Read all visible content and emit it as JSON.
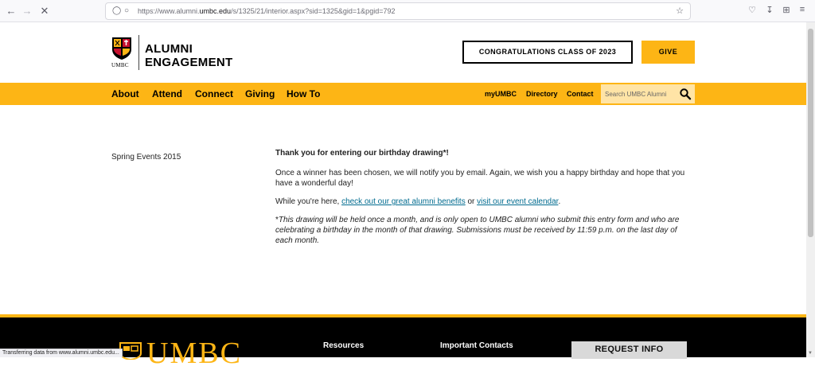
{
  "browser": {
    "url_prefix": "https://www.alumni.",
    "url_domain": "umbc.edu",
    "url_suffix": "/s/1325/21/interior.aspx?sid=1325&gid=1&pgid=792",
    "icons": [
      "back-icon",
      "forward-icon",
      "stop-icon",
      "shield-icon",
      "lock-icon",
      "bookmark-star-icon",
      "pocket-icon",
      "download-icon",
      "extensions-icon",
      "menu-icon"
    ],
    "status_text": "Transferring data from www.alumni.umbc.edu..."
  },
  "header": {
    "logo_small": "UMBC",
    "logo_line1": "ALUMNI",
    "logo_line2": "ENGAGEMENT",
    "congrats_button": "CONGRATULATIONS CLASS OF 2023",
    "give_button": "GIVE"
  },
  "nav": {
    "main": [
      "About",
      "Attend",
      "Connect",
      "Giving",
      "How To"
    ],
    "utility": [
      "myUMBC",
      "Directory",
      "Contact"
    ],
    "search_placeholder": "Search UMBC Alumni"
  },
  "sidebar": {
    "label": "Spring Events 2015"
  },
  "content": {
    "lead": "Thank  you for entering our birthday drawing*!",
    "para1": "Once a winner has been chosen, we will notify you by email. Again, we wish you a happy birthday and hope that you have a wonderful day!",
    "para2_prefix": "While you're here, ",
    "link1": "check out our great alumni benefits",
    "para2_mid": " or ",
    "link2": "visit our event calendar",
    "para2_suffix": ".",
    "note_star": "*",
    "note": "This drawing will be held once a month, and is only open to UMBC alumni who submit this entry form and who are celebrating a birthday in the month of that drawing. Submissions must be received by 11:59 p.m. on the last day of each month."
  },
  "footer": {
    "logo_text": "UMBC",
    "resources": "Resources",
    "important_contacts": "Important Contacts",
    "request_info": "REQUEST INFO"
  },
  "colors": {
    "brand_gold": "#fdb515",
    "link": "#006b8f",
    "footer_bg": "#000000"
  }
}
